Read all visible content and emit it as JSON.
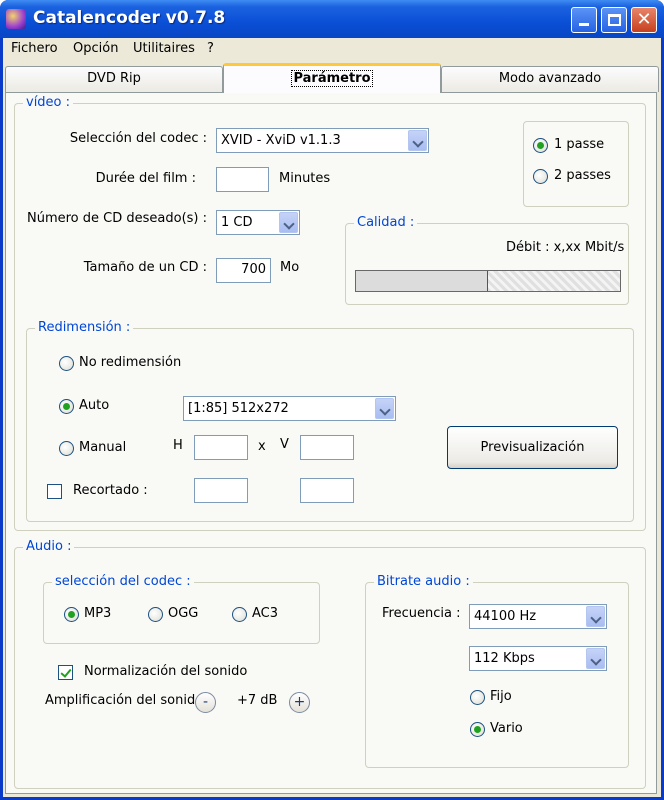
{
  "window": {
    "title": "Catalencoder v0.7.8"
  },
  "menu": [
    "Fichero",
    "Opción",
    "Utilitaires",
    "?"
  ],
  "tabs": [
    {
      "label": "DVD Rip",
      "active": false
    },
    {
      "label": "Parámetro",
      "active": true
    },
    {
      "label": "Modo avanzado",
      "active": false
    }
  ],
  "video": {
    "group_label": "vídeo :",
    "codec_label": "Selección del codec :",
    "codec_value": "XVID - XviD v1.1.3",
    "duration_label": "Durée del film :",
    "duration_value": "",
    "duration_unit": "Minutes",
    "cd_count_label": "Número de CD deseado(s) :",
    "cd_count_value": "1 CD",
    "cd_size_label": "Tamaño de un CD :",
    "cd_size_value": "700",
    "cd_size_unit": "Mo",
    "pass_1": "1 passe",
    "pass_2": "2 passes",
    "pass_selected": "1 passe",
    "quality_label": "Calidad :",
    "bitrate_text": "Débit : x,xx Mbit/s",
    "quality_fraction": 0.5
  },
  "resize": {
    "group_label": "Redimensión :",
    "no_resize": "No redimensión",
    "auto": "Auto",
    "manual": "Manual",
    "selected": "Auto",
    "auto_value": "[1:85] 512x272",
    "h_label": "H",
    "x_label": "x",
    "v_label": "V",
    "crop_label": "Recortado :",
    "crop_checked": false,
    "preview_button": "Previsualización"
  },
  "audio": {
    "group_label": "Audio :",
    "codec_group_label": "selección del codec :",
    "codec_mp3": "MP3",
    "codec_ogg": "OGG",
    "codec_ac3": "AC3",
    "codec_selected": "MP3",
    "normalize_label": "Normalización del sonido",
    "normalize_checked": true,
    "amplify_label": "Amplificación del sonido",
    "amplify_value": "+7 dB",
    "minus_symbol": "-",
    "plus_symbol": "+",
    "bitrate_group_label": "Bitrate audio :",
    "frequency_label": "Frecuencia :",
    "frequency_value": "44100 Hz",
    "bitrate_value": "112 Kbps",
    "mode_fixed": "Fijo",
    "mode_variable": "Vario",
    "mode_selected": "Vario"
  },
  "colors": {
    "title_bar": "#0a4fd6",
    "group_label": "#0046d5",
    "radio_dot": "#21a121",
    "active_tab_accent": "#ffc83c"
  }
}
